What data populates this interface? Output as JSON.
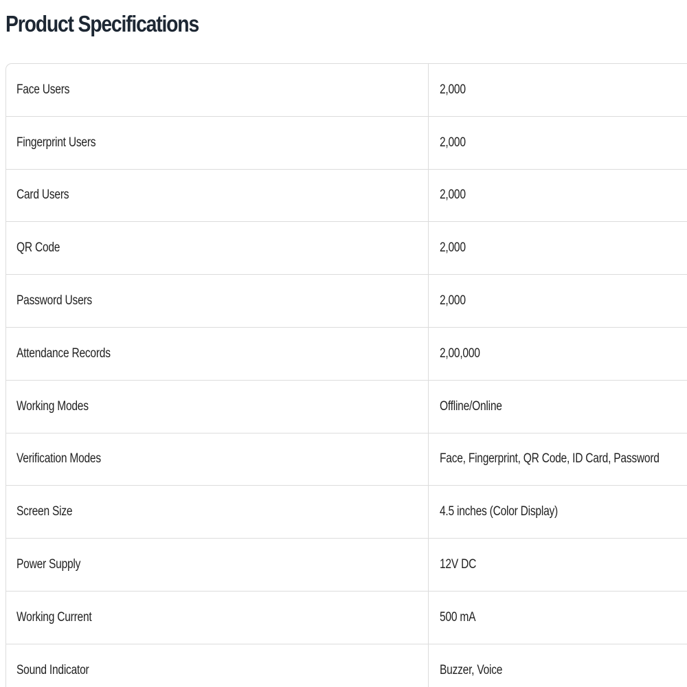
{
  "page_title": "Product Specifications",
  "specs": [
    {
      "label": "Face Users",
      "value": "2,000"
    },
    {
      "label": "Fingerprint Users",
      "value": "2,000"
    },
    {
      "label": "Card Users",
      "value": "2,000"
    },
    {
      "label": "QR Code",
      "value": "2,000"
    },
    {
      "label": "Password Users",
      "value": "2,000"
    },
    {
      "label": "Attendance Records",
      "value": "2,00,000"
    },
    {
      "label": "Working Modes",
      "value": "Offline/Online"
    },
    {
      "label": "Verification Modes",
      "value": "Face, Fingerprint, QR Code, ID Card, Password"
    },
    {
      "label": "Screen Size",
      "value": "4.5 inches (Color Display)"
    },
    {
      "label": "Power Supply",
      "value": "12V DC"
    },
    {
      "label": "Working Current",
      "value": "500 mA"
    },
    {
      "label": "Sound Indicator",
      "value": "Buzzer, Voice"
    }
  ]
}
